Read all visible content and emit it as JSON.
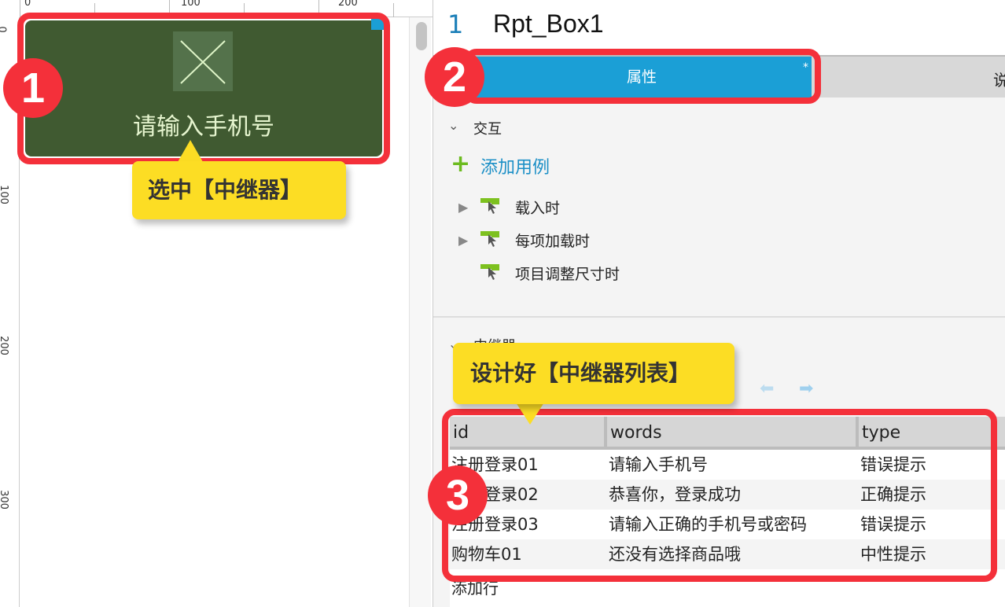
{
  "canvas": {
    "ruler_top": [
      "0",
      "100",
      "200"
    ],
    "ruler_left": [
      "0",
      "100",
      "200",
      "300"
    ],
    "repeater_text": "请输入手机号"
  },
  "panel": {
    "index": "1",
    "widget_name": "Rpt_Box1",
    "tabs": [
      {
        "label": "属性",
        "modified": "*",
        "active": true
      },
      {
        "label": "说",
        "active": false
      }
    ],
    "interaction_section": "交互",
    "add_case": "添加用例",
    "events": [
      {
        "label": "载入时",
        "expandable": true
      },
      {
        "label": "每项加载时",
        "expandable": true
      },
      {
        "label": "项目调整尺寸时",
        "expandable": false
      }
    ],
    "repeater_section": "中继器",
    "table": {
      "columns": [
        "id",
        "words",
        "type"
      ],
      "rows": [
        [
          "注册登录01",
          "请输入手机号",
          "错误提示"
        ],
        [
          "注册登录02",
          "恭喜你，登录成功",
          "正确提示"
        ],
        [
          "注册登录03",
          "请输入正确的手机号或密码",
          "错误提示"
        ],
        [
          "购物车01",
          "还没有选择商品哦",
          "中性提示"
        ]
      ]
    },
    "add_row": "添加行"
  },
  "annotations": {
    "badges": [
      "1",
      "2",
      "3"
    ],
    "callout1": "选中【中继器】",
    "callout2": "设计好【中继器列表】"
  },
  "colors": {
    "accent": "#1b9fd6",
    "highlight": "#f4303a",
    "callout": "#fcdd24",
    "repeater_bg": "#405a31",
    "add_green": "#6cbb1f"
  }
}
